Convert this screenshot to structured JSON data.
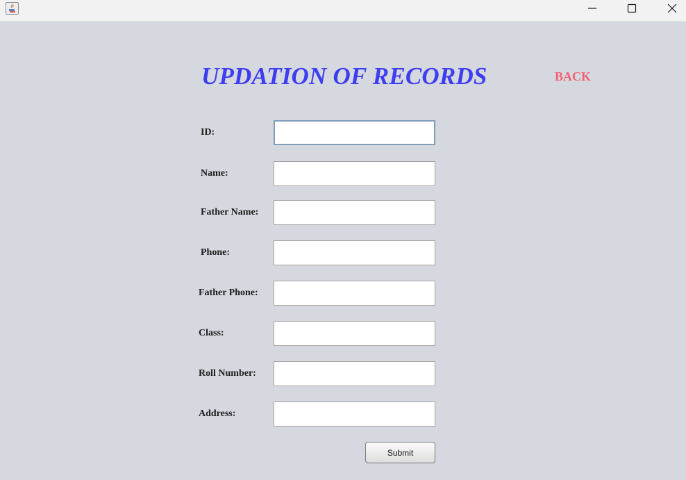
{
  "window": {
    "icon": "java-app-icon",
    "controls": [
      "minimize-icon",
      "maximize-icon",
      "close-icon"
    ]
  },
  "header": {
    "title": "UPDATION OF RECORDS",
    "back_label": "BACK"
  },
  "colors": {
    "title": "#3d3df2",
    "back": "#f06272",
    "background": "#d6d8df"
  },
  "form": {
    "fields": [
      {
        "label": "ID:",
        "value": ""
      },
      {
        "label": "Name:",
        "value": ""
      },
      {
        "label": "Father Name:",
        "value": ""
      },
      {
        "label": "Phone:",
        "value": ""
      },
      {
        "label": "Father Phone:",
        "value": ""
      },
      {
        "label": "Class:",
        "value": ""
      },
      {
        "label": "Roll Number:",
        "value": ""
      },
      {
        "label": "Address:",
        "value": ""
      }
    ],
    "submit_label": "Submit"
  }
}
